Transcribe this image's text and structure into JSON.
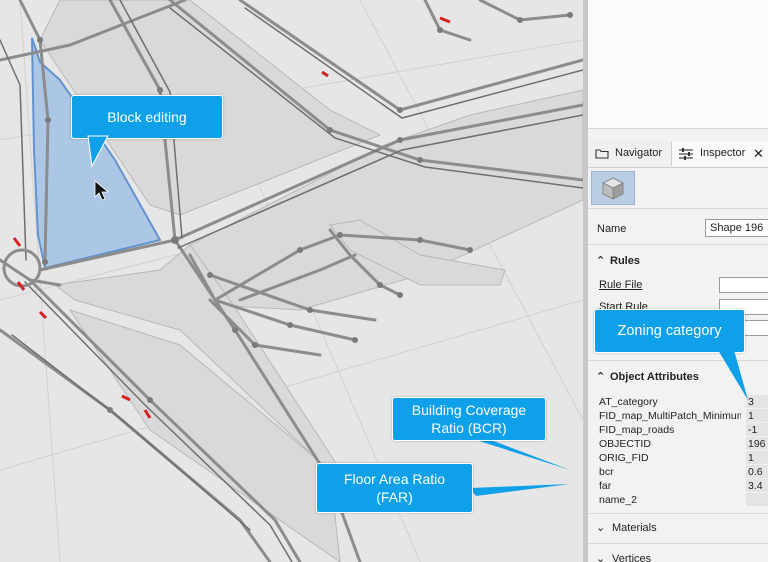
{
  "panel": {
    "tabs": [
      {
        "label": "Navigator",
        "icon": "folder-icon"
      },
      {
        "label": "Inspector",
        "icon": "inspector-sliders-icon"
      }
    ],
    "close_glyph": "✕",
    "shape_name_label": "Name",
    "shape_name_value": "Shape 196",
    "sections": {
      "rules": {
        "title": "Rules",
        "rule_file_label": "Rule File",
        "start_rule_label": "Start Rule"
      },
      "attributes": {
        "title": "Object Attributes"
      },
      "materials": {
        "title": "Materials"
      },
      "vertices": {
        "title": "Vertices"
      }
    },
    "attributes": [
      {
        "key": "AT_category",
        "value": "3"
      },
      {
        "key": "FID_map_MultiPatch_Minimum",
        "value": "1"
      },
      {
        "key": "FID_map_roads",
        "value": "-1"
      },
      {
        "key": "OBJECTID",
        "value": "196"
      },
      {
        "key": "ORIG_FID",
        "value": "1"
      },
      {
        "key": "bcr",
        "value": "0.6"
      },
      {
        "key": "far",
        "value": "3.4"
      },
      {
        "key": "name_2",
        "value": ""
      }
    ]
  },
  "callouts": {
    "block_editing": "Block editing",
    "zoning": "Zoning category",
    "bcr_line1": "Building Coverage",
    "bcr_line2": "Ratio (BCR)",
    "far_line1": "Floor Area Ratio",
    "far_line2": "(FAR)"
  },
  "colors": {
    "callout_bg": "#0ea0e8",
    "selected_block": "#a9c6e6",
    "road": "#8c8c8c",
    "node": "#7a7a7a"
  }
}
